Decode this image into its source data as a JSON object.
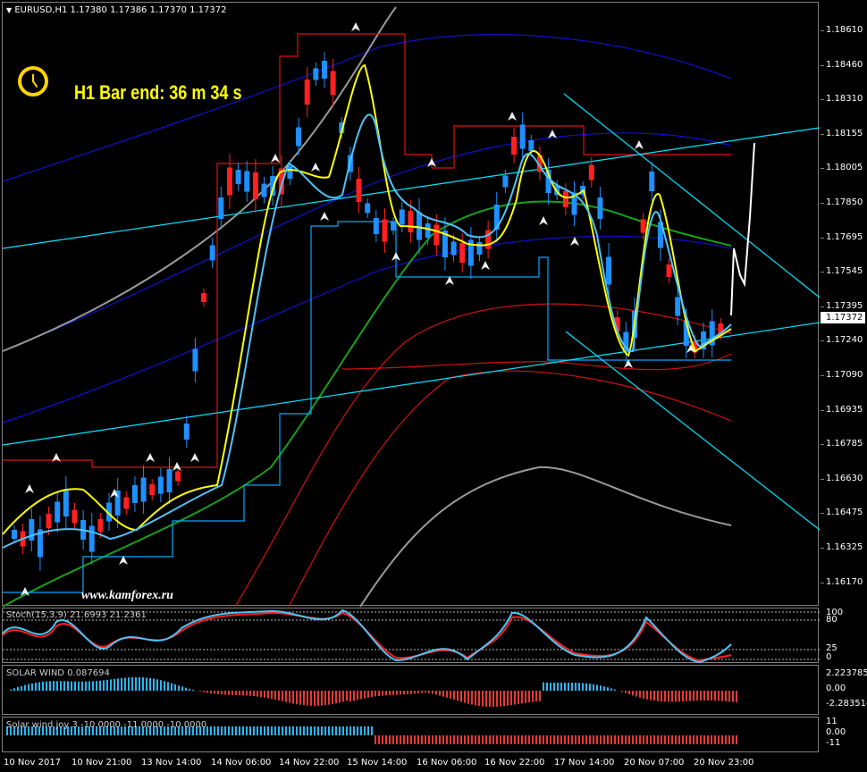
{
  "header": {
    "symbol_line": "EURUSD,H1  1.17380 1.17386 1.17370 1.17372"
  },
  "timer": {
    "text": "H1 Bar end: 36 m 34 s"
  },
  "watermark": "www.kamforex.ru",
  "price_axis": [
    "1.18610",
    "1.18460",
    "1.18310",
    "1.18155",
    "1.18005",
    "1.17850",
    "1.17695",
    "1.17545",
    "1.17395",
    "1.17240",
    "1.17090",
    "1.16935",
    "1.16785",
    "1.16630",
    "1.16475",
    "1.16325",
    "1.16170"
  ],
  "current_price": "1.17372",
  "stoch": {
    "label": "Stoch(15,3,9) 21.6993 21.2361",
    "levels": [
      "100",
      "80",
      "25",
      "0"
    ]
  },
  "solar1": {
    "label": "SOLAR WIND 0.087694",
    "levels": [
      "2.223785",
      "0.00",
      "-2.283514"
    ]
  },
  "solar2": {
    "label": "Solar wind joy 3 -10.0000 -11.0000 -10.0000",
    "levels": [
      "11",
      "0.00",
      "-11"
    ]
  },
  "time_axis": [
    "10 Nov 2017",
    "10 Nov 21:00",
    "13 Nov 14:00",
    "14 Nov 06:00",
    "14 Nov 22:00",
    "15 Nov 14:00",
    "16 Nov 06:00",
    "16 Nov 22:00",
    "17 Nov 14:00",
    "20 Nov 07:00",
    "20 Nov 23:00"
  ],
  "colors": {
    "candle_up": "#1e90ff",
    "candle_down": "#ff2020",
    "channel": "#00e5ff",
    "timer": "#ffff00"
  }
}
